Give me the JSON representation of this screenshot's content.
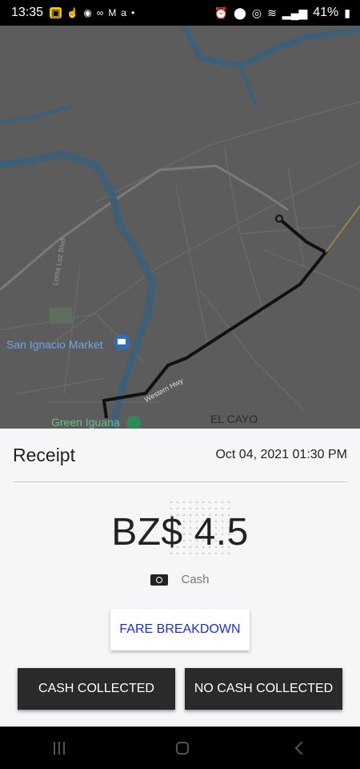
{
  "status_bar": {
    "time": "13:35",
    "battery": "41%"
  },
  "map": {
    "labels": {
      "market": "San Ignacio Market",
      "green_iguana": "Green Iguana",
      "el_cayo": "EL CAYO",
      "western_hwy": "Western Hwy",
      "loma_luz": "Loma Luz Blvd"
    }
  },
  "receipt": {
    "title": "Receipt",
    "date": "Oct 04, 2021 01:30 PM",
    "amount": "BZ$ 4.5",
    "payment_method": "Cash",
    "fare_breakdown_label": "FARE BREAKDOWN",
    "cash_collected_label": "CASH COLLECTED",
    "no_cash_collected_label": "NO CASH COLLECTED"
  },
  "colors": {
    "fare_link": "#1a2fd6",
    "button_bg": "#2a2a2a",
    "map_bg": "#5c5c5c",
    "river": "#3f5f77",
    "route": "#111111"
  }
}
